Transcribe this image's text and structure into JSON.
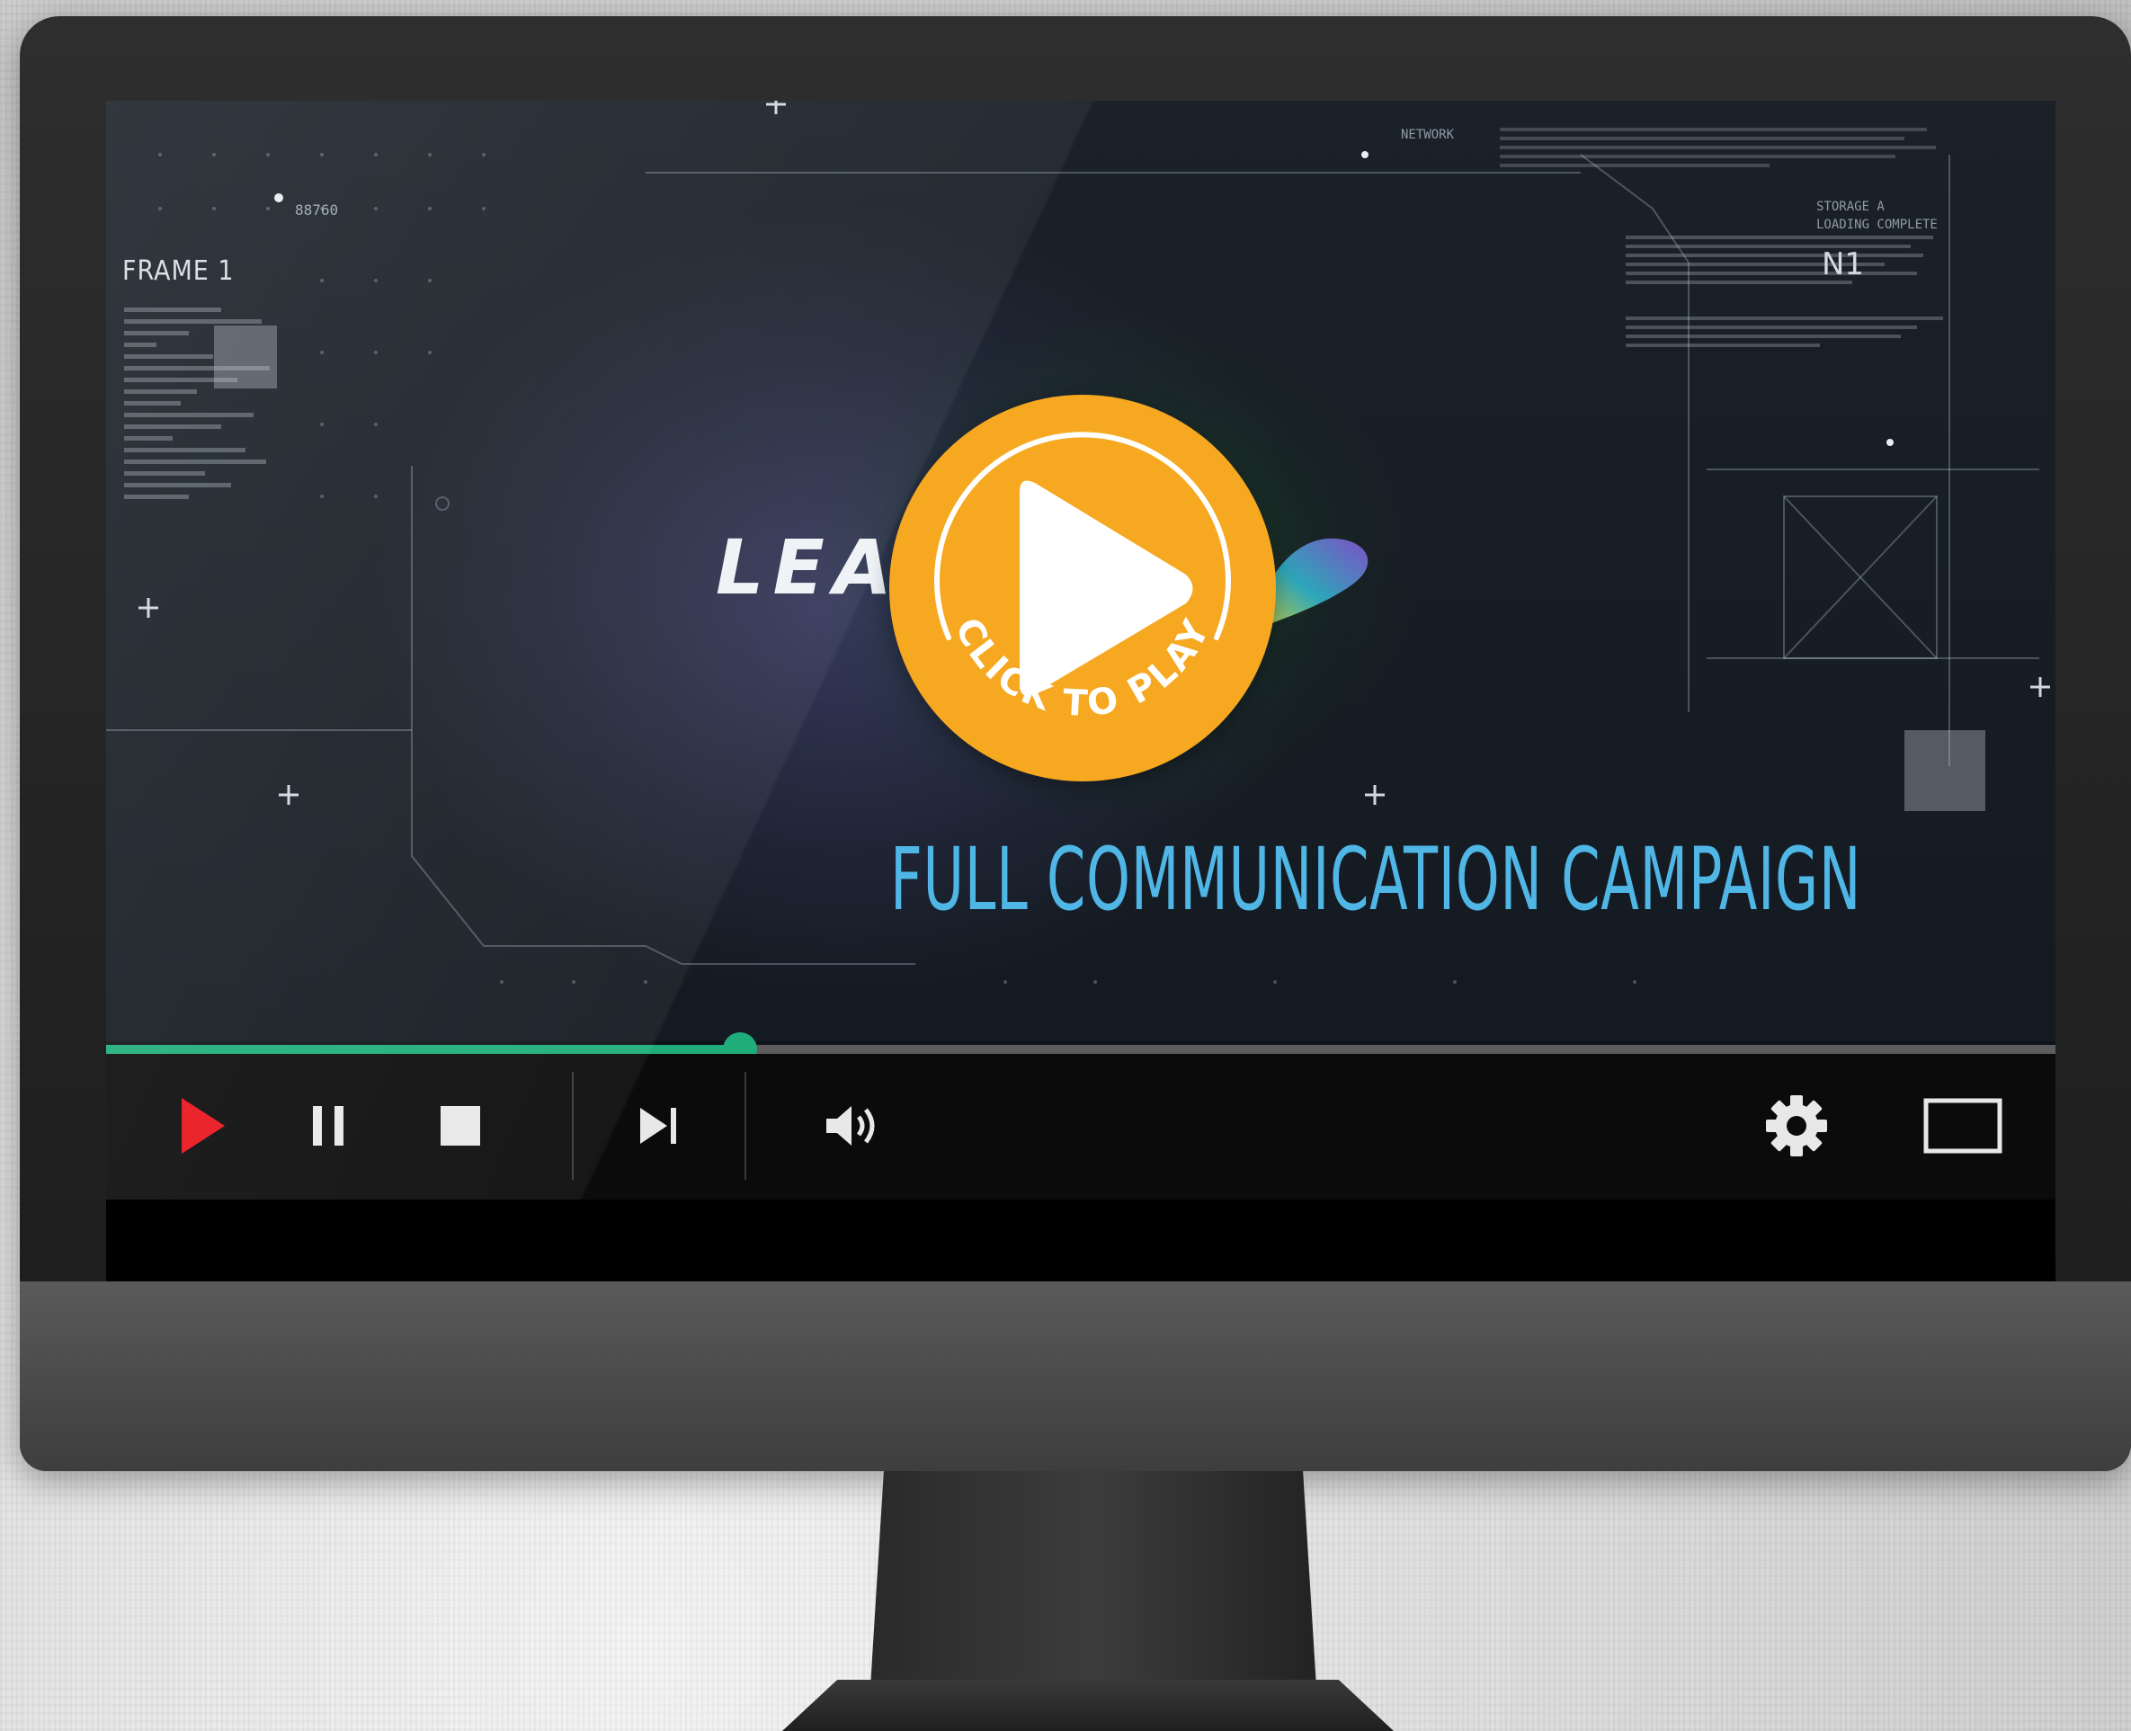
{
  "video": {
    "frame_label": "FRAME 1",
    "frame_number": "88760",
    "network_label": "NETWORK",
    "storage_label_1": "STORAGE A",
    "storage_label_2": "LOADING COMPLETE",
    "n1_label": "N1",
    "logo_text": "LEA",
    "title": "FULL COMMUNICATION CAMPAIGN"
  },
  "overlay": {
    "cta_text": "CLICK TO PLAY"
  },
  "progress": {
    "fraction": 0.325
  },
  "controls": {
    "play_icon": "play-icon",
    "pause_icon": "pause-icon",
    "stop_icon": "stop-icon",
    "next_icon": "skip-next-icon",
    "volume_icon": "volume-icon",
    "settings_icon": "gear-icon",
    "fullscreen_icon": "fullscreen-icon"
  },
  "colors": {
    "accent_orange": "#f6a821",
    "progress_green": "#1fae7a",
    "play_red": "#e8141c",
    "title_blue": "#4fb6e6"
  }
}
